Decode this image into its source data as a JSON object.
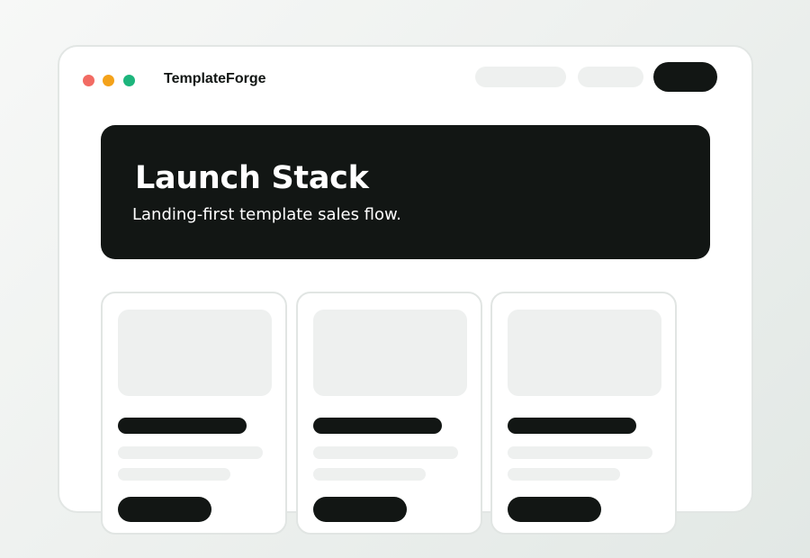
{
  "app": {
    "brand_name": "TemplateForge"
  },
  "window_controls": {
    "close_color": "#f26b63",
    "minimize_color": "#f4a21a",
    "maximize_color": "#1db57c"
  },
  "hero": {
    "title": "Launch Stack",
    "subtitle": "Landing-first template sales flow."
  },
  "colors": {
    "ink": "#121614",
    "placeholder": "#eef0ef",
    "border": "#e2e6e4"
  },
  "cards_count_label": ""
}
